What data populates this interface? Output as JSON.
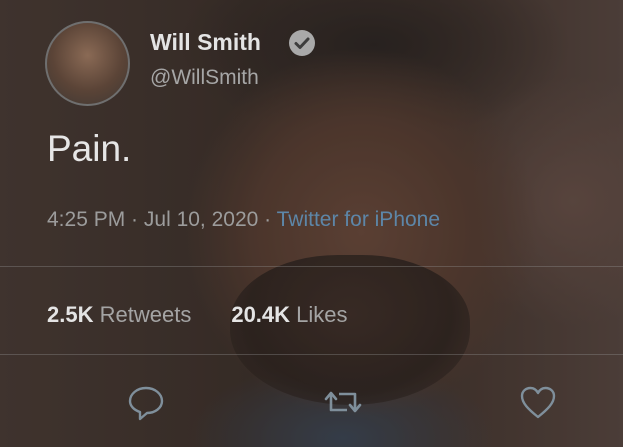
{
  "tweet": {
    "name": "Will Smith",
    "handle": "@WillSmith",
    "text": "Pain.",
    "time": "4:25 PM",
    "separator": " · ",
    "date": "Jul 10, 2020",
    "source": "Twitter for iPhone",
    "retweets_count": "2.5K",
    "retweets_label": "Retweets",
    "likes_count": "20.4K",
    "likes_label": "Likes"
  },
  "icons": {
    "verified": "verified-badge-icon",
    "reply": "reply-icon",
    "retweet": "retweet-icon",
    "like": "like-icon"
  },
  "colors": {
    "source_link": "#5d86a8",
    "text": "#e6e6e6",
    "muted": "#9c9c9c"
  }
}
